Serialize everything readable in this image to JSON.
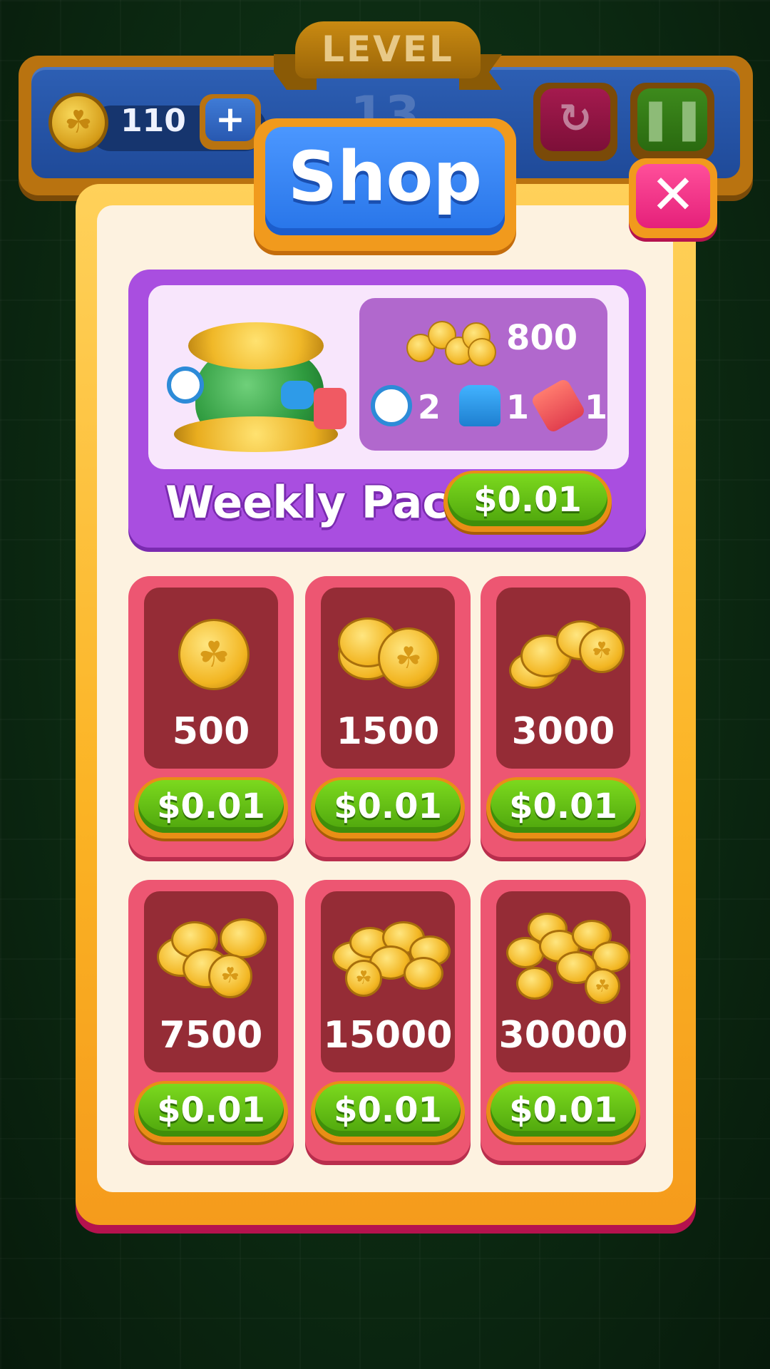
{
  "topbar": {
    "coins": "110",
    "plus_label": "+",
    "level_label": "LEVEL",
    "level_number": "13",
    "restart_icon": "↻",
    "pause_icon": "❚❚"
  },
  "shop": {
    "title": "Shop",
    "close_icon": "✕"
  },
  "weekly_pack": {
    "title": "Weekly Pack",
    "coins": "800",
    "items": [
      {
        "icon": "stopwatch-icon",
        "qty": "2"
      },
      {
        "icon": "hammer-icon",
        "qty": "1"
      },
      {
        "icon": "rocket-icon",
        "qty": "1"
      }
    ],
    "price": "$0.01"
  },
  "packs": [
    {
      "amount": "500",
      "price": "$0.01"
    },
    {
      "amount": "1500",
      "price": "$0.01"
    },
    {
      "amount": "3000",
      "price": "$0.01"
    },
    {
      "amount": "7500",
      "price": "$0.01"
    },
    {
      "amount": "15000",
      "price": "$0.01"
    },
    {
      "amount": "30000",
      "price": "$0.01"
    }
  ],
  "colors": {
    "background": "#0c2a12",
    "panel_border": "#fbb324",
    "panel_fill": "#fdf2e0",
    "title_button": "#2774e8",
    "close_button": "#e5207a",
    "weekly_pack": "#a94ee0",
    "coin_card": "#ed5672",
    "coin_card_inner": "#952c36",
    "buy_button": "#4da40c"
  }
}
